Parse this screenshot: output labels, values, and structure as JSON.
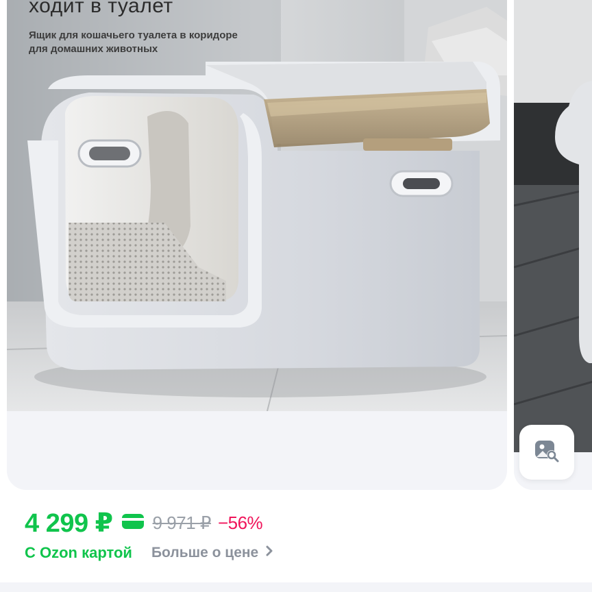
{
  "gallery": {
    "overlay_title": "ходит в туалет",
    "overlay_subtitle": "Ящик для кошачьего туалета в коридоре для домашних животных",
    "zoom_icon": "image-search-icon"
  },
  "price": {
    "current": "4 299 ₽",
    "card_icon": "card-icon",
    "old": "9 971 ₽",
    "discount": "−56%",
    "ozon_card_label": "С Ozon картой",
    "more_label": "Больше о цене",
    "more_icon": "chevron-right-icon"
  },
  "colors": {
    "accent_green": "#10c44c",
    "discount_pink": "#f0145a",
    "muted_gray": "#9aa0a8",
    "card_bg": "#f3f4f8"
  }
}
